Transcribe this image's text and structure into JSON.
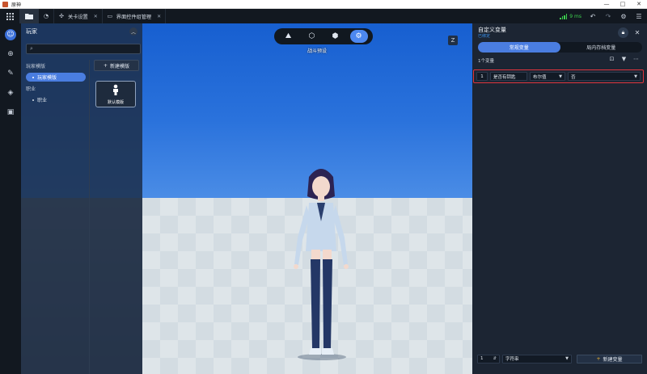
{
  "window": {
    "title": "原神",
    "controls": [
      "—",
      "□",
      "✕"
    ]
  },
  "tabs": [
    {
      "label": "",
      "icon": "folder-icon"
    },
    {
      "label": "",
      "icon": "dashboard-icon"
    },
    {
      "label": "关卡设置",
      "icon": "level-settings-icon",
      "close": "✕"
    },
    {
      "label": "界面控件组管理",
      "icon": "ui-widget-icon",
      "close": "✕"
    }
  ],
  "network": {
    "ping": "9 ms",
    "color": "#3ccf4e"
  },
  "left_panel": {
    "title": "玩家",
    "search_placeholder": "",
    "groups": [
      {
        "label": "玩家模版",
        "items": [
          {
            "label": "玩家模版",
            "selected": true
          }
        ]
      },
      {
        "label": "职业",
        "items": [
          {
            "label": "职业",
            "selected": false
          }
        ]
      }
    ],
    "new_template_button": "新建模版",
    "template_card": {
      "label": "默认模版"
    }
  },
  "viewport": {
    "mode_label": "战斗预设",
    "z_button": "Z",
    "active_tool": "settings-icon"
  },
  "right_panel": {
    "title": "自定义变量",
    "subtitle": "已绑定",
    "tabs": [
      {
        "label": "常规变量",
        "active": true
      },
      {
        "label": "局内存档变量",
        "active": false
      }
    ],
    "count_label": "1个变量",
    "variables": [
      {
        "index": "1",
        "name": "是否有钥匙",
        "type": "布尔值",
        "value": "否"
      }
    ],
    "new_var": {
      "index": "1",
      "type": "字符串",
      "button": "新建变量"
    }
  },
  "colors": {
    "accent": "#4a7de0",
    "highlight": "#e0353d",
    "sky": "#1b63cf"
  }
}
